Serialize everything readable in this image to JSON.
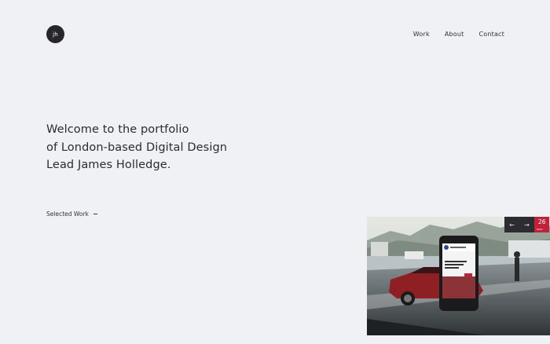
{
  "header": {
    "logo_text": "jh",
    "nav": [
      {
        "label": "Work"
      },
      {
        "label": "About"
      },
      {
        "label": "Contact"
      }
    ]
  },
  "hero": {
    "lines": [
      "Welcome to the portfolio",
      "of London-based Digital Design",
      "Lead James Holledge."
    ]
  },
  "selected_work": {
    "label": "Selected Work"
  },
  "slider": {
    "prev_icon": "arrow-left-icon",
    "next_icon": "arrow-right-icon",
    "prev_glyph": "←",
    "next_glyph": "→",
    "counter": "26",
    "counter_label": "BMW",
    "accent_color": "#c0213b",
    "control_color": "#2d2d31"
  },
  "colors": {
    "background": "#f0f1f5",
    "text": "#2a2a2e",
    "logo_bg": "#27272b"
  }
}
